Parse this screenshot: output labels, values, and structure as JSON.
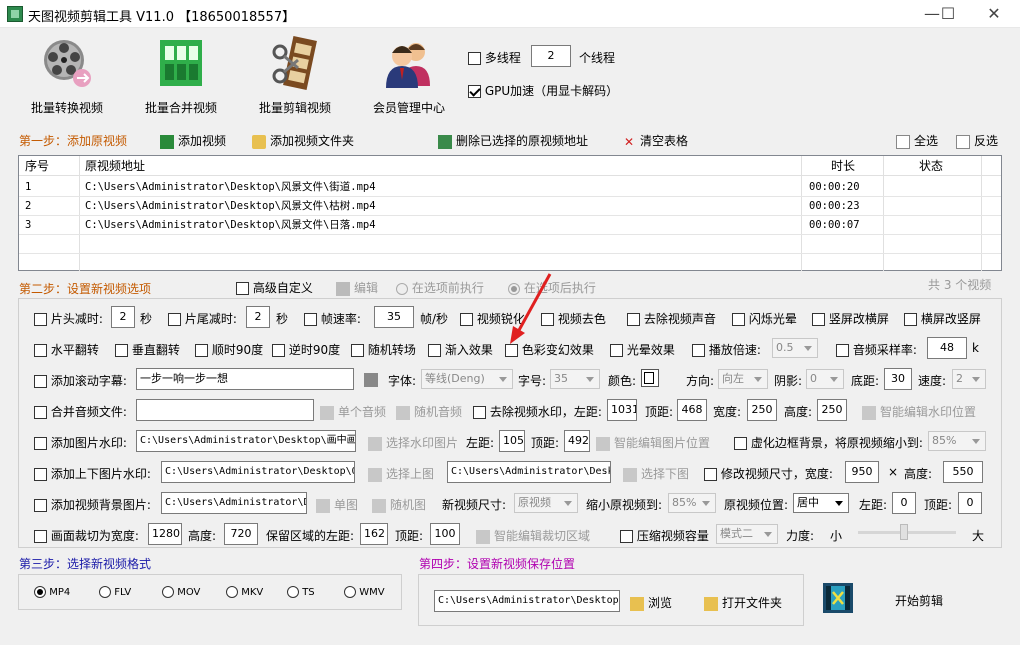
{
  "window": {
    "title": "天图视频剪辑工具 V11.0 【18650018557】",
    "min": "—",
    "max": "☐",
    "close": "✕"
  },
  "toolbar": {
    "batch_convert": "批量转换视频",
    "batch_merge": "批量合并视频",
    "batch_edit": "批量剪辑视频",
    "member": "会员管理中心"
  },
  "threads": {
    "label": "多线程",
    "value": "2",
    "suffix": "个线程"
  },
  "gpu": {
    "label": "GPU加速（用显卡解码）"
  },
  "step1": {
    "title": "第一步：添加原视频",
    "add_video": "添加视频",
    "add_folder": "添加视频文件夹",
    "delete_selected": "删除已选择的原视频地址",
    "clear": "清空表格",
    "select_all": "全选",
    "invert": "反选"
  },
  "table": {
    "headers": [
      "序号",
      "原视频地址",
      "时长",
      "状态"
    ],
    "rows": [
      {
        "no": "1",
        "path": "C:\\Users\\Administrator\\Desktop\\风景文件\\街道.mp4",
        "duration": "00:00:20",
        "status": ""
      },
      {
        "no": "2",
        "path": "C:\\Users\\Administrator\\Desktop\\风景文件\\枯树.mp4",
        "duration": "00:00:23",
        "status": ""
      },
      {
        "no": "3",
        "path": "C:\\Users\\Administrator\\Desktop\\风景文件\\日落.mp4",
        "duration": "00:00:07",
        "status": ""
      }
    ]
  },
  "step2": {
    "title": "第二步：设置新视频选项",
    "advanced": "高级自定义",
    "edit": "编辑",
    "before": "在选项前执行",
    "after": "在选项后执行",
    "count": "共 3 个视频"
  },
  "opt": {
    "head_cut": "片头减时:",
    "head_val": "2",
    "sec1": "秒",
    "tail_cut": "片尾减时:",
    "tail_val": "2",
    "sec2": "秒",
    "fps": "帧速率:",
    "fps_val": "35",
    "fps_unit": "帧/秒",
    "sharpen": "视频锐化",
    "decolor": "视频去色",
    "mute": "去除视频声音",
    "flash": "闪烁光晕",
    "v2h": "竖屏改横屏",
    "h2v": "横屏改竖屏",
    "hflip": "水平翻转",
    "vflip": "垂直翻转",
    "cw90": "顺时90度",
    "ccw90": "逆时90度",
    "rand_trans": "随机转场",
    "fadein": "渐入效果",
    "color_fx": "色彩变幻效果",
    "light_fx": "光晕效果",
    "speed": "播放倍速:",
    "speed_val": "0.5",
    "sample": "音频采样率:",
    "sample_val": "48",
    "sample_unit": "k",
    "subtitle": "添加滚动字幕:",
    "subtitle_val": "一步一响一步一想",
    "font": "字体:",
    "font_val": "等线(Deng)",
    "fsize": "字号:",
    "fsize_val": "35",
    "color": "颜色:",
    "dir": "方向:",
    "dir_val": "向左",
    "shadow": "阴影:",
    "shadow_val": "0",
    "bottom": "底距:",
    "bottom_val": "30",
    "spd": "速度:",
    "spd_val": "2",
    "merge_audio": "合并音频文件:",
    "single_audio": "单个音频",
    "rand_audio": "随机音频",
    "rm_wm": "去除视频水印，左距:",
    "wm_left": "1031",
    "wm_top_l": "顶距:",
    "wm_top": "468",
    "wm_w_l": "宽度:",
    "wm_w": "250",
    "wm_h_l": "高度:",
    "wm_h": "250",
    "smart_wm": "智能编辑水印位置",
    "img_wm": "添加图片水印:",
    "img_wm_path": "C:\\Users\\Administrator\\Desktop\\画中画",
    "sel_wm_img": "选择水印图片",
    "iw_left_l": "左距:",
    "iw_left": "1055",
    "iw_top_l": "顶距:",
    "iw_top": "492",
    "smart_img": "智能编辑图片位置",
    "blur_bg": "虚化边框背景，将原视频缩小到:",
    "blur_val": "85%",
    "tb_wm": "添加上下图片水印:",
    "tb_path1": "C:\\Users\\Administrator\\Desktop\\Q",
    "sel_top": "选择上图",
    "tb_path2": "C:\\Users\\Administrator\\Desk",
    "sel_bottom": "选择下图",
    "resize": "修改视频尺寸，宽度:",
    "rs_w": "950",
    "times": "×",
    "rs_h_l": "高度:",
    "rs_h": "550",
    "bg_img": "添加视频背景图片:",
    "bg_path": "C:\\Users\\Administrator\\Desktop\\D",
    "single_img": "单图",
    "rand_img": "随机图",
    "new_size": "新视频尺寸:",
    "new_size_val": "原视频",
    "shrink": "缩小原视频到:",
    "shrink_val": "85%",
    "pos": "原视频位置:",
    "pos_val": "居中",
    "bl_l": "左距:",
    "bl": "0",
    "bt_l": "顶距:",
    "bt": "0",
    "crop": "画面裁切为宽度:",
    "crop_w": "1280",
    "crop_h_l": "高度:",
    "crop_h": "720",
    "keep_l": "保留区域的左距:",
    "keep_left": "162",
    "keep_t": "顶距:",
    "keep_top": "100",
    "smart_crop": "智能编辑裁切区域",
    "compress": "压缩视频容量",
    "mode": "模式二",
    "force": "力度:",
    "small": "小",
    "large": "大"
  },
  "step3": {
    "title": "第三步：选择新视频格式",
    "formats": [
      "MP4",
      "FLV",
      "MOV",
      "MKV",
      "TS",
      "WMV"
    ]
  },
  "step4": {
    "title": "第四步：设置新视频保存位置",
    "path": "C:\\Users\\Administrator\\Desktop\\",
    "browse": "浏览",
    "open_folder": "打开文件夹",
    "start": "开始剪辑"
  },
  "colors": {
    "step_orange": "#c45a00",
    "step_blue": "#1a1aa8",
    "step_purple": "#b000b0",
    "arrow_red": "#e02020"
  }
}
